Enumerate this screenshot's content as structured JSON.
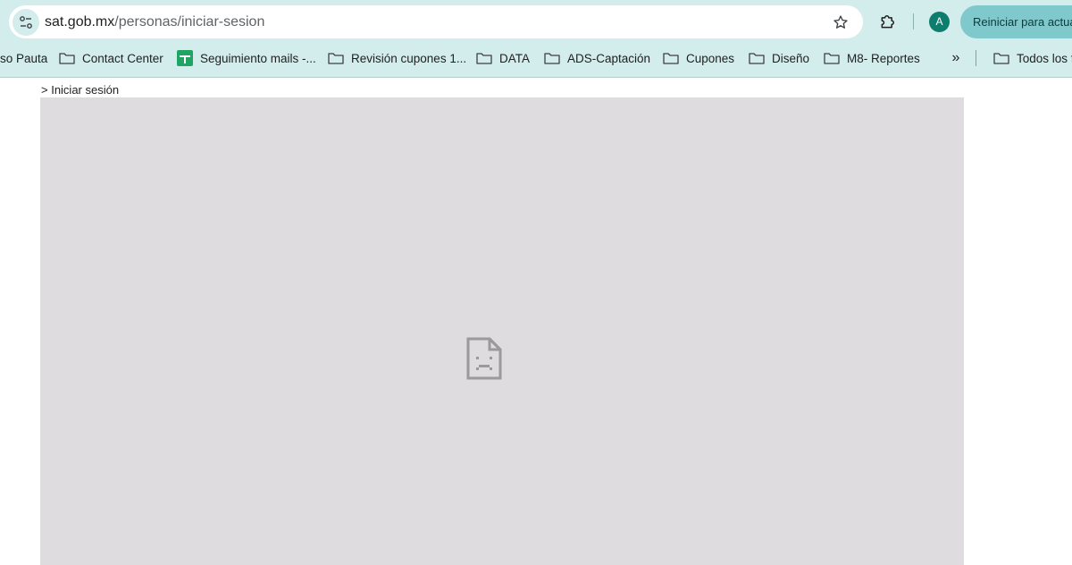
{
  "browser": {
    "url_host": "sat.gob.mx",
    "url_path": "/personas/iniciar-sesion",
    "profile_initial": "A",
    "relaunch_label": "Reiniciar para actua",
    "icons": {
      "site_info": "tune-icon",
      "bookmark": "star-icon",
      "extensions": "puzzle-icon",
      "overflow": "chevron-double-right-icon"
    },
    "colors": {
      "chrome": "#d3ecec",
      "profile": "#0f7d6e",
      "relaunch": "#7fc9cc"
    }
  },
  "bookmarks": {
    "items": [
      {
        "label": "so Pauta",
        "icon": "none"
      },
      {
        "label": "Contact Center",
        "icon": "folder-icon"
      },
      {
        "label": "Seguimiento mails -...",
        "icon": "sheets-icon"
      },
      {
        "label": "Revisión cupones 1...",
        "icon": "folder-icon"
      },
      {
        "label": "DATA",
        "icon": "folder-icon"
      },
      {
        "label": "ADS-Captación",
        "icon": "folder-icon"
      },
      {
        "label": "Cupones",
        "icon": "folder-icon"
      },
      {
        "label": "Diseño",
        "icon": "folder-icon"
      },
      {
        "label": "M8- Reportes",
        "icon": "folder-icon"
      }
    ],
    "overflow_label": "»",
    "all_bookmarks_label": "Todos los f"
  },
  "page": {
    "breadcrumb": "> Iniciar sesión",
    "frame_icon": "sad-document-icon",
    "frame_color": "#dedcdf"
  }
}
